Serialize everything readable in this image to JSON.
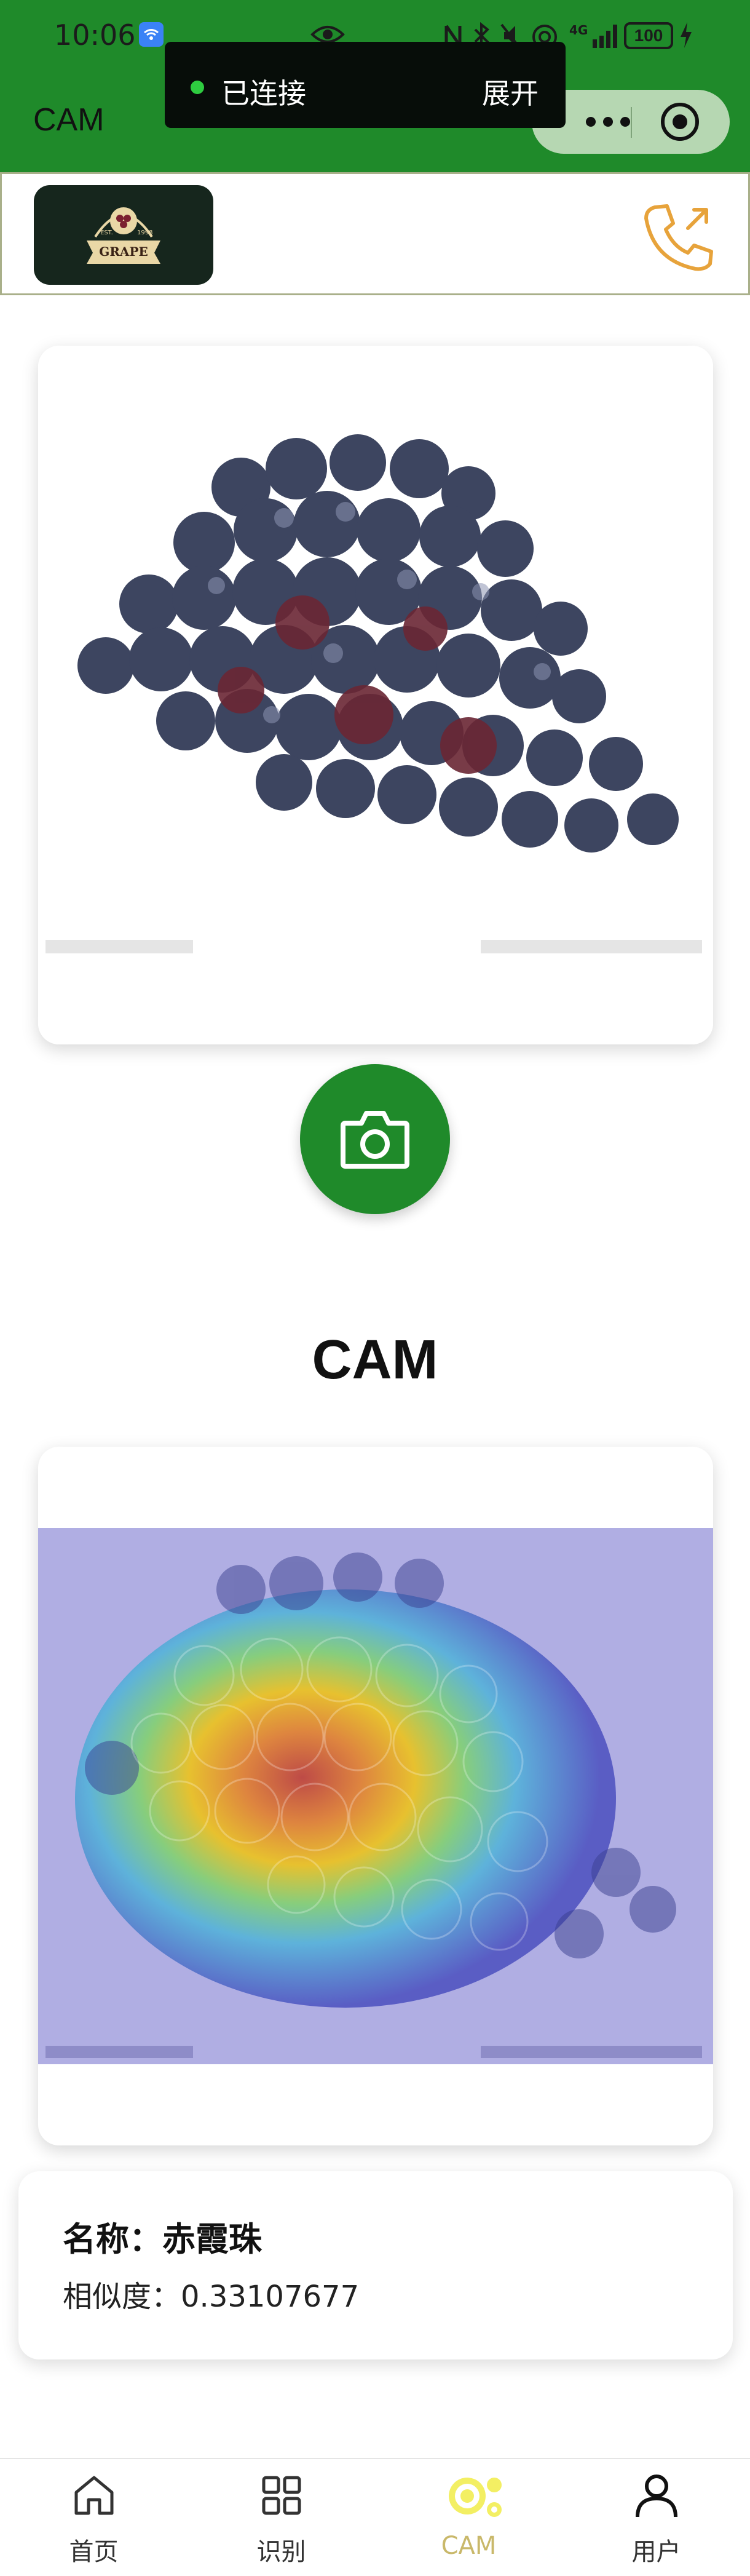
{
  "status_bar": {
    "time": "10:06",
    "battery": "100"
  },
  "nav": {
    "title": "CAM"
  },
  "toast": {
    "text": "已连接",
    "action": "展开"
  },
  "brand": {
    "logo_text": "GRAPE"
  },
  "camera_button": {
    "icon": "camera-icon"
  },
  "section": {
    "title": "CAM"
  },
  "result": {
    "name_label": "名称：",
    "name_value": "赤霞珠",
    "similarity_label": "相似度：",
    "similarity_value": "0.33107677"
  },
  "tabs": [
    {
      "label": "首页",
      "icon": "home-icon",
      "active": false
    },
    {
      "label": "识别",
      "icon": "grid-icon",
      "active": false
    },
    {
      "label": "CAM",
      "icon": "cam-target-icon",
      "active": true
    },
    {
      "label": "用户",
      "icon": "user-icon",
      "active": false
    }
  ],
  "colors": {
    "primary": "#1f8a2a",
    "active_tab": "#c9b86a",
    "phone_icon": "#e7a33b"
  }
}
